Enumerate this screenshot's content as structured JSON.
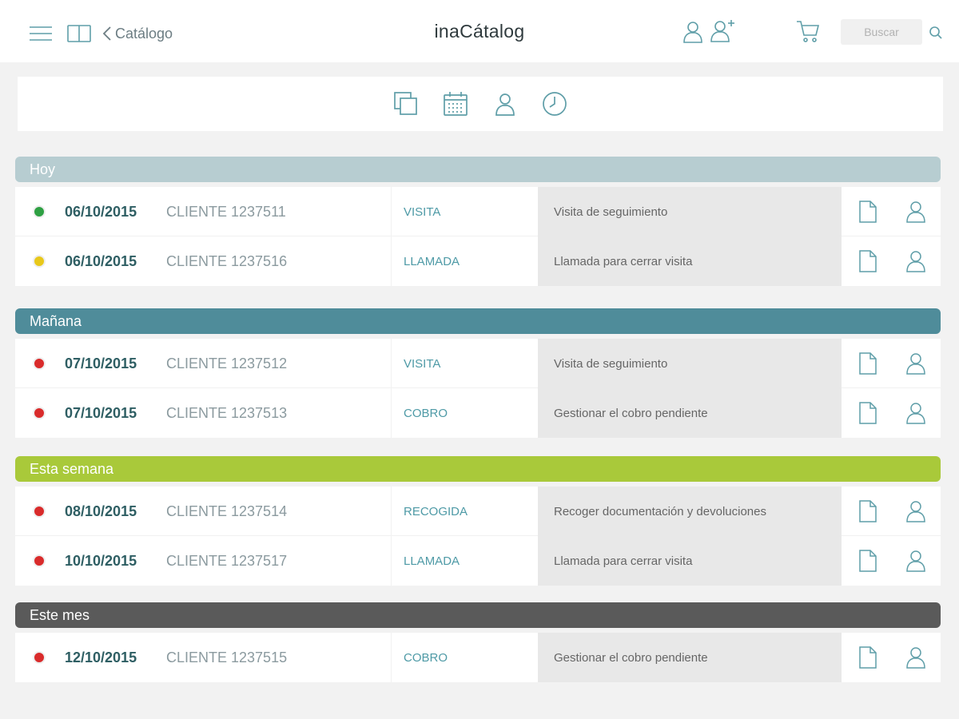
{
  "header": {
    "back_label": "Catálogo",
    "title": "inaCátalog",
    "search_placeholder": "Buscar"
  },
  "icons": {
    "menu": "hamburger-menu-icon",
    "book": "book-icon",
    "back": "chevron-left-icon",
    "user": "user-icon",
    "add_user": "add-user-icon",
    "cart": "cart-icon",
    "search": "search-icon",
    "filters": [
      "layers-icon",
      "calendar-icon",
      "user-icon",
      "clock-icon"
    ],
    "row_doc": "document-icon",
    "row_person": "person-icon"
  },
  "colors": {
    "accent": "#5f9ea8",
    "status_green": "#2ea043",
    "status_yellow": "#e8c81a",
    "status_red": "#d92b2b"
  },
  "sections": [
    {
      "label": "Hoy",
      "color": "#b7cdd1",
      "rows": [
        {
          "status": "#2ea043",
          "date": "06/10/2015",
          "client": "CLIENTE 1237511",
          "type": "VISITA",
          "description": "Visita de seguimiento"
        },
        {
          "status": "#e8c81a",
          "date": "06/10/2015",
          "client": "CLIENTE 1237516",
          "type": "LLAMADA",
          "description": "Llamada para cerrar visita"
        }
      ]
    },
    {
      "label": "Mañana",
      "color": "#4f8c9a",
      "rows": [
        {
          "status": "#d92b2b",
          "date": "07/10/2015",
          "client": "CLIENTE 1237512",
          "type": "VISITA",
          "description": "Visita de seguimiento"
        },
        {
          "status": "#d92b2b",
          "date": "07/10/2015",
          "client": "CLIENTE 1237513",
          "type": "COBRO",
          "description": "Gestionar el cobro pendiente"
        }
      ]
    },
    {
      "label": "Esta semana",
      "color": "#a9c93a",
      "rows": [
        {
          "status": "#d92b2b",
          "date": "08/10/2015",
          "client": "CLIENTE 1237514",
          "type": "RECOGIDA",
          "description": "Recoger documentación y devoluciones"
        },
        {
          "status": "#d92b2b",
          "date": "10/10/2015",
          "client": "CLIENTE 1237517",
          "type": "LLAMADA",
          "description": "Llamada para cerrar visita"
        }
      ]
    },
    {
      "label": "Este mes",
      "color": "#5a5a5a",
      "rows": [
        {
          "status": "#d92b2b",
          "date": "12/10/2015",
          "client": "CLIENTE 1237515",
          "type": "COBRO",
          "description": "Gestionar el cobro pendiente"
        }
      ]
    }
  ]
}
